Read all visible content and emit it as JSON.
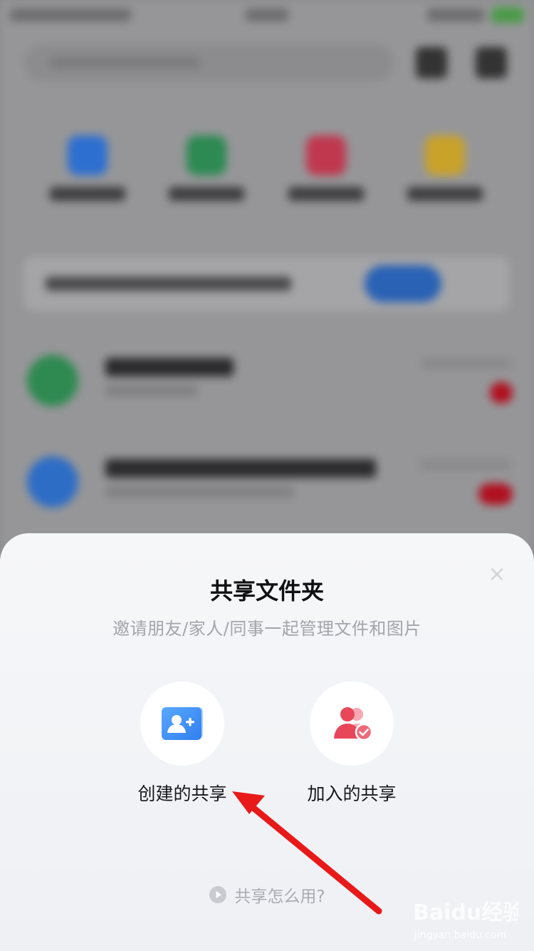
{
  "sheet": {
    "title": "共享文件夹",
    "subtitle": "邀请朋友/家人/同事一起管理文件和图片",
    "options": [
      {
        "label": "创建的共享",
        "icon": "add-user-card-icon"
      },
      {
        "label": "加入的共享",
        "icon": "joined-users-check-icon"
      }
    ],
    "help_label": "共享怎么用?",
    "close_icon": "close-icon"
  },
  "watermark": {
    "brand": "Baidu经验",
    "domain": "jingyan.baidu.com"
  },
  "colors": {
    "accent_blue": "#3a8df5",
    "accent_red": "#e8475a",
    "annotation_arrow": "#e81919"
  }
}
